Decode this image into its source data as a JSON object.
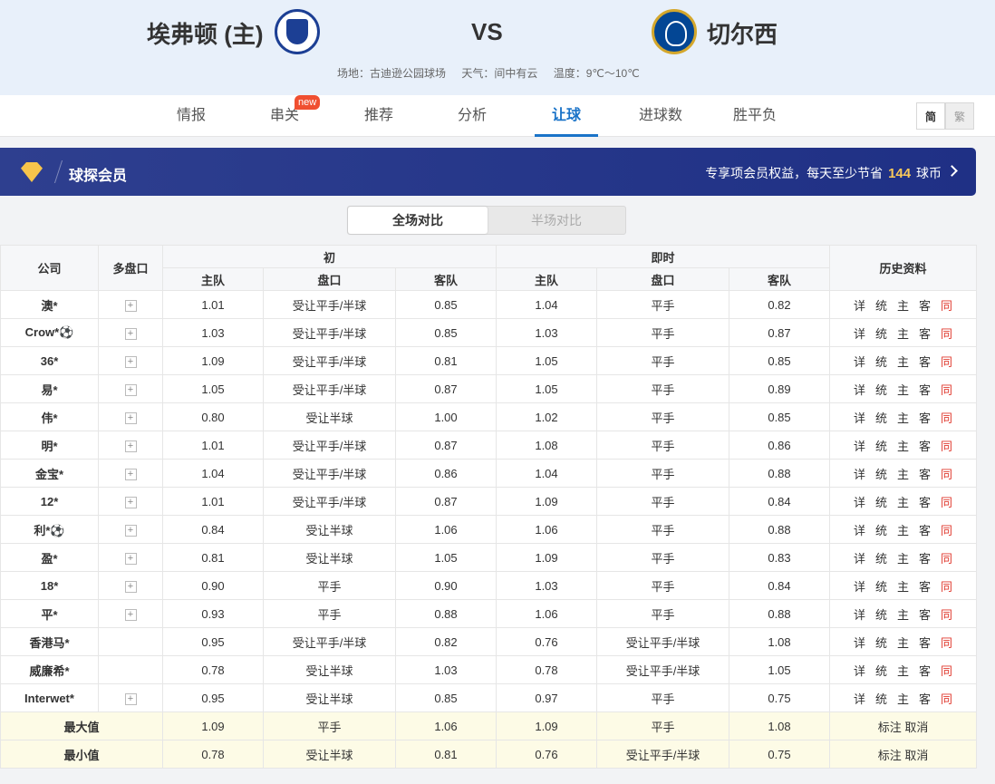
{
  "match": {
    "home": "埃弗顿 (主)",
    "vs": "VS",
    "away": "切尔西",
    "venue": "场地：古迪逊公园球场",
    "weather": "天气：间中有云",
    "temperature": "温度：9℃～10℃"
  },
  "tabs": [
    {
      "label": "情报"
    },
    {
      "label": "串关"
    },
    {
      "label": "推荐"
    },
    {
      "label": "分析"
    },
    {
      "label": "让球"
    },
    {
      "label": "进球数"
    },
    {
      "label": "胜平负"
    }
  ],
  "active_tab": "让球",
  "new_badge": "new",
  "lang": {
    "simplified": "简",
    "traditional": "繁"
  },
  "banner": {
    "title": "球探会员",
    "text_before": "专享项会员权益，每天至少节省",
    "coins": "144",
    "text_after": "球币"
  },
  "toggle": {
    "full": "全场对比",
    "half": "半场对比"
  },
  "table": {
    "headers": {
      "company": "公司",
      "multi": "多盘口",
      "initial": "初",
      "live": "即时",
      "history": "历史资料",
      "home": "主队",
      "line": "盘口",
      "away": "客队"
    },
    "history_links": [
      "详",
      "统",
      "主",
      "客",
      "同"
    ],
    "rows": [
      {
        "company": "澳*",
        "multi": true,
        "ih": "1.01",
        "il": "受让平手/半球",
        "ia": "0.85",
        "lh": "1.04",
        "ll": "平手",
        "la": "0.82"
      },
      {
        "company": "Crow*⚽",
        "multi": true,
        "ih": "1.03",
        "il": "受让平手/半球",
        "ia": "0.85",
        "lh": "1.03",
        "ll": "平手",
        "la": "0.87"
      },
      {
        "company": "36*",
        "multi": true,
        "ih": "1.09",
        "il": "受让平手/半球",
        "ia": "0.81",
        "lh": "1.05",
        "ll": "平手",
        "la": "0.85"
      },
      {
        "company": "易*",
        "multi": true,
        "ih": "1.05",
        "il": "受让平手/半球",
        "ia": "0.87",
        "lh": "1.05",
        "ll": "平手",
        "la": "0.89"
      },
      {
        "company": "伟*",
        "multi": true,
        "ih": "0.80",
        "il": "受让半球",
        "ia": "1.00",
        "lh": "1.02",
        "ll": "平手",
        "la": "0.85"
      },
      {
        "company": "明*",
        "multi": true,
        "ih": "1.01",
        "il": "受让平手/半球",
        "ia": "0.87",
        "lh": "1.08",
        "ll": "平手",
        "la": "0.86"
      },
      {
        "company": "金宝*",
        "multi": true,
        "ih": "1.04",
        "il": "受让平手/半球",
        "ia": "0.86",
        "lh": "1.04",
        "ll": "平手",
        "la": "0.88"
      },
      {
        "company": "12*",
        "multi": true,
        "ih": "1.01",
        "il": "受让平手/半球",
        "ia": "0.87",
        "lh": "1.09",
        "ll": "平手",
        "la": "0.84"
      },
      {
        "company": "利*⚽",
        "multi": true,
        "ih": "0.84",
        "il": "受让半球",
        "ia": "1.06",
        "lh": "1.06",
        "ll": "平手",
        "la": "0.88"
      },
      {
        "company": "盈*",
        "multi": true,
        "ih": "0.81",
        "il": "受让半球",
        "ia": "1.05",
        "lh": "1.09",
        "ll": "平手",
        "la": "0.83"
      },
      {
        "company": "18*",
        "multi": true,
        "ih": "0.90",
        "il": "平手",
        "ia": "0.90",
        "lh": "1.03",
        "ll": "平手",
        "la": "0.84"
      },
      {
        "company": "平*",
        "multi": true,
        "ih": "0.93",
        "il": "平手",
        "ia": "0.88",
        "lh": "1.06",
        "ll": "平手",
        "la": "0.88"
      },
      {
        "company": "香港马*",
        "multi": false,
        "ih": "0.95",
        "il": "受让平手/半球",
        "ia": "0.82",
        "lh": "0.76",
        "ll": "受让平手/半球",
        "la": "1.08"
      },
      {
        "company": "威廉希*",
        "multi": false,
        "ih": "0.78",
        "il": "受让半球",
        "ia": "1.03",
        "lh": "0.78",
        "ll": "受让平手/半球",
        "la": "1.05"
      },
      {
        "company": "Interwet*",
        "multi": true,
        "ih": "0.95",
        "il": "受让半球",
        "ia": "0.85",
        "lh": "0.97",
        "ll": "平手",
        "la": "0.75"
      }
    ],
    "summary": [
      {
        "label": "最大值",
        "ih": "1.09",
        "il": "平手",
        "ia": "1.06",
        "lh": "1.09",
        "ll": "平手",
        "la": "1.08",
        "mark": "标注",
        "cancel": "取消"
      },
      {
        "label": "最小值",
        "ih": "0.78",
        "il": "受让半球",
        "ia": "0.81",
        "lh": "0.76",
        "ll": "受让平手/半球",
        "la": "0.75",
        "mark": "标注",
        "cancel": "取消"
      }
    ]
  }
}
